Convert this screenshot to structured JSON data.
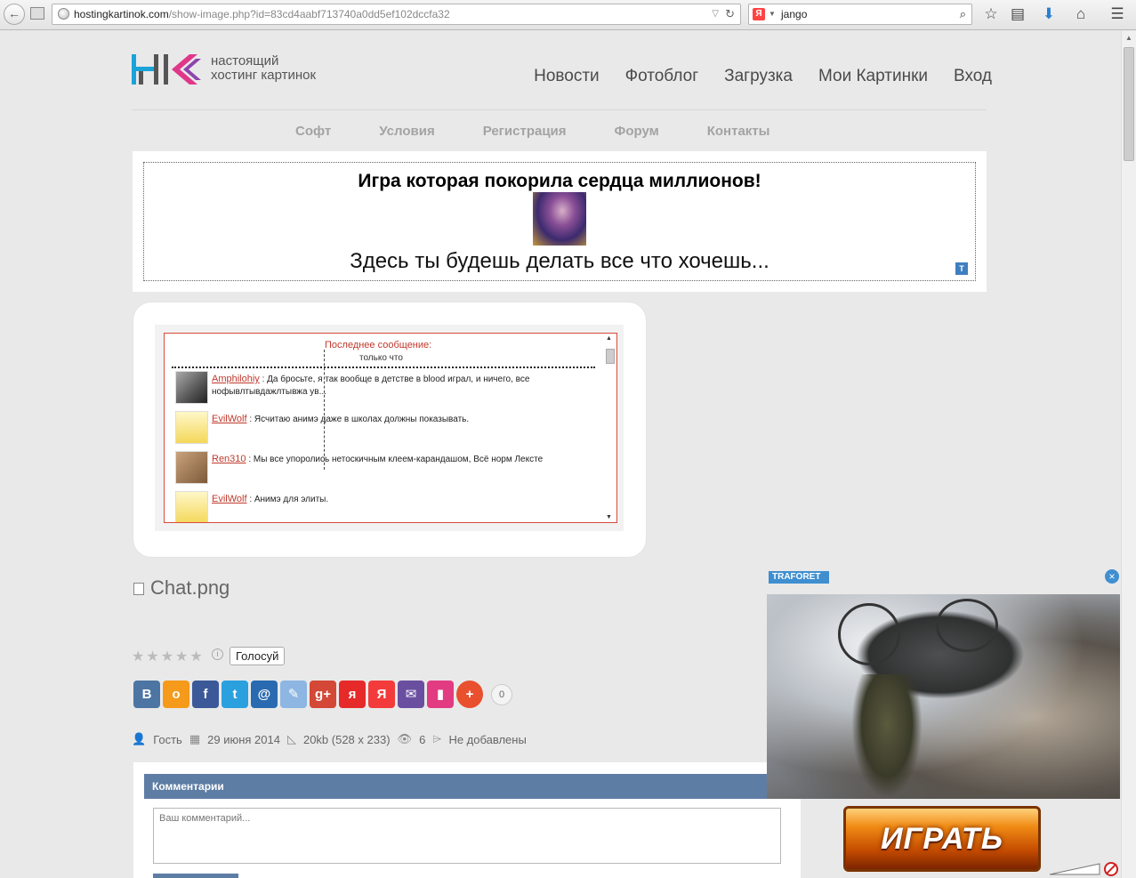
{
  "browser": {
    "url_host": "hostingkartinok.com",
    "url_path": "/show-image.php?id=83cd4aabf713740a0dd5ef102dccfa32",
    "search_query": "jango",
    "search_engine_icon": "Я"
  },
  "site": {
    "logo_line1": "настоящий",
    "logo_line2": "хостинг картинок",
    "main_nav": [
      "Новости",
      "Фотоблог",
      "Загрузка",
      "Мои Картинки",
      "Вход"
    ],
    "sub_nav": [
      "Софт",
      "Условия",
      "Регистрация",
      "Форум",
      "Контакты"
    ]
  },
  "ad": {
    "title": "Игра которая покорила сердца миллионов!",
    "subtitle": "Здесь ты будешь делать все что хочешь...",
    "badge": "T"
  },
  "chat": {
    "last_label": "Последнее сообщение:",
    "last_time": "только что",
    "messages": [
      {
        "nick": "Amphilohiy",
        "text": ": Да бросьте, я так вообще в детстве в blood играл, и ничего, все нофывлтывдажлтывжа ув..."
      },
      {
        "nick": "EvilWolf",
        "text": ": Ясчитаю анимэ даже в школах должны показывать."
      },
      {
        "nick": "Ren310",
        "text": ": Мы все упоролись нетоскичным клеем-карандашом, Всё норм Лексте"
      },
      {
        "nick": "EvilWolf",
        "text": ": Анимэ для элиты."
      }
    ]
  },
  "file": {
    "name": "Chat.png",
    "vote_label": "Голосуй",
    "share_count": "0",
    "author": "Гость",
    "date": "29 июня 2014",
    "size": "20kb (528 x 233)",
    "views": "6",
    "tags": "Не добавлены"
  },
  "share_buttons": [
    {
      "label": "В",
      "color": "#4c75a3"
    },
    {
      "label": "о",
      "color": "#f59a1a"
    },
    {
      "label": "f",
      "color": "#3b5998"
    },
    {
      "label": "t",
      "color": "#2aa0df"
    },
    {
      "label": "@",
      "color": "#2a6ab0"
    },
    {
      "label": "✎",
      "color": "#8db6e2"
    },
    {
      "label": "g+",
      "color": "#d34836"
    },
    {
      "label": "я",
      "color": "#e62a2a"
    },
    {
      "label": "Я",
      "color": "#f33b3b"
    },
    {
      "label": "✉",
      "color": "#6a4fa0"
    },
    {
      "label": "▮",
      "color": "#e23b82"
    },
    {
      "label": "+",
      "color": "#e9502e"
    }
  ],
  "comments": {
    "header": "Комментарии",
    "placeholder": "Ваш комментарий..."
  },
  "popup": {
    "label": "TRAFORET",
    "close": "×",
    "play_label": "ИГРАТЬ"
  }
}
